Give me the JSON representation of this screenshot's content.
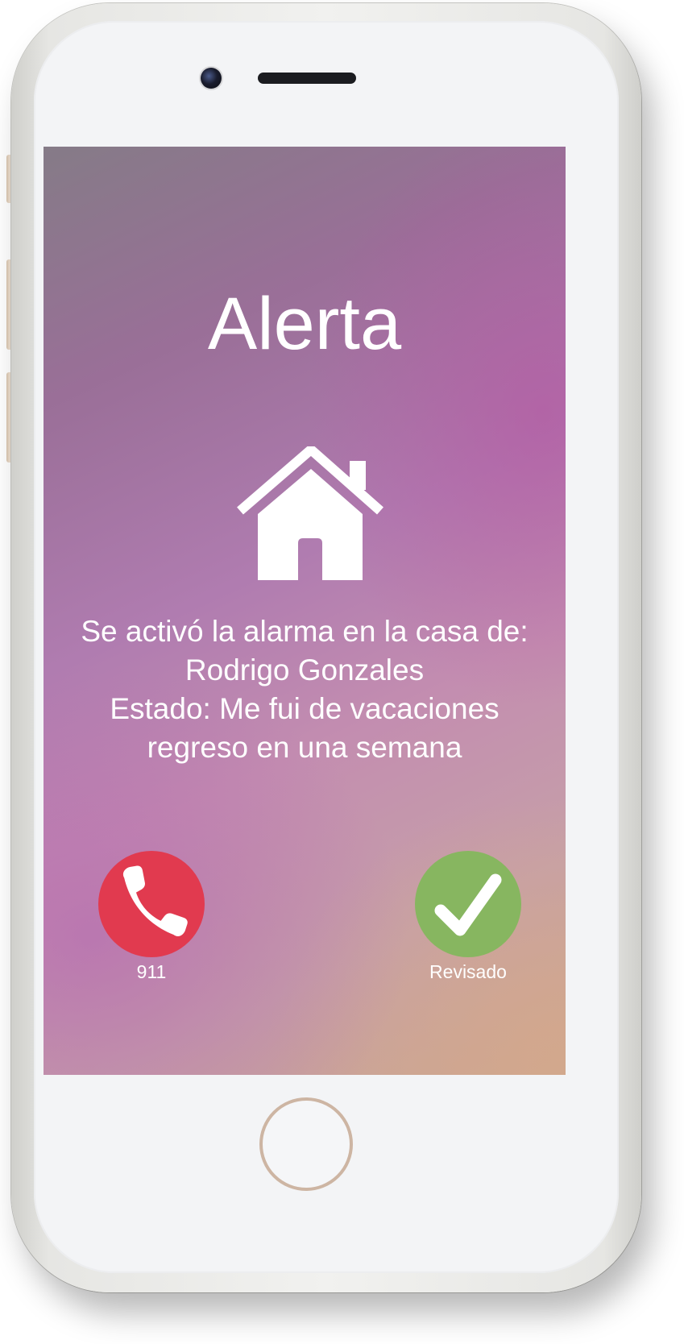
{
  "alert": {
    "title": "Alerta",
    "icon": "house-icon",
    "message_lines": [
      "Se activó la alarma en la casa de:",
      "Rodrigo Gonzales",
      "Estado: Me fui de vacaciones",
      "regreso en una semana"
    ]
  },
  "actions": {
    "emergency": {
      "label": "911",
      "icon": "phone-icon",
      "color": "#e13a4f"
    },
    "reviewed": {
      "label": "Revisado",
      "icon": "checkmark-icon",
      "color": "#87b660"
    }
  },
  "device": {
    "frame_color": "#f3f4f6",
    "accent_color": "#cdb5a3"
  }
}
